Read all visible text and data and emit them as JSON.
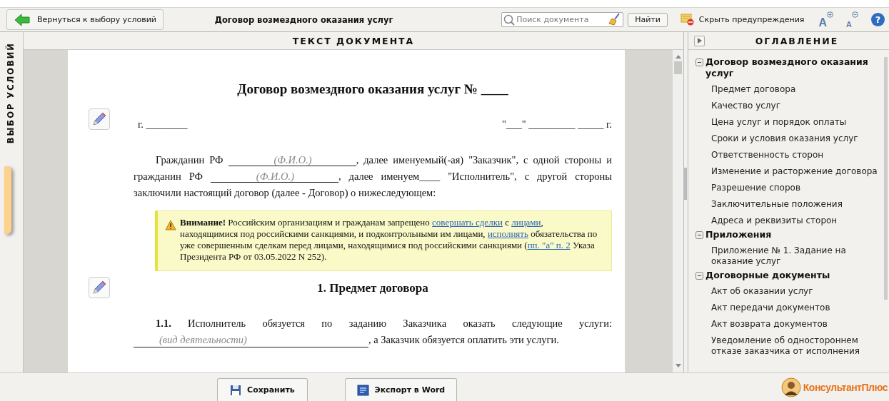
{
  "toolbar": {
    "back_button": "Вернуться к выбору условий",
    "title": "Договор возмездного оказания услуг",
    "search": {
      "placeholder": "Поиск документа"
    },
    "find_button": "Найти",
    "hide_warnings_button": "Скрыть предупреждения",
    "font_buttons": [
      {
        "kind": "increase",
        "label": "A"
      },
      {
        "kind": "decrease",
        "label": "A"
      }
    ],
    "help_button": "?"
  },
  "side_tab": {
    "label": "ВЫБОР УСЛОВИЙ"
  },
  "document": {
    "header": "ТЕКСТ ДОКУМЕНТА",
    "title": "Договор возмездного оказания услуг № ____",
    "city": "г. ________",
    "date": "\"___\" _________ _____ г.",
    "intro": [
      {
        "kind": "text",
        "text": "Гражданин РФ "
      },
      {
        "kind": "blank",
        "hint": "(Ф.И.О.)"
      },
      {
        "kind": "text",
        "text": ", далее именуемый(-ая) \"Заказчик\", с одной стороны и гражданин РФ "
      },
      {
        "kind": "blank",
        "hint": "(Ф.И.О.)"
      },
      {
        "kind": "text",
        "text": ", далее именуем____ \"Исполнитель\", с другой стороны заключили настоящий договор (далее - Договор) о нижеследующем:"
      }
    ],
    "warning": [
      {
        "kind": "text",
        "text": "**Внимание!** Российским организациям и гражданам запрещено "
      },
      {
        "kind": "link",
        "text": "совершать сделки"
      },
      {
        "kind": "text",
        "text": " с "
      },
      {
        "kind": "link",
        "text": "лицами"
      },
      {
        "kind": "text",
        "text": ", находящимися под российскими санкциями, и подконтрольными им лицами, "
      },
      {
        "kind": "link",
        "text": "исполнять"
      },
      {
        "kind": "text",
        "text": " обязательства по уже совершенным сделкам перед лицами, находящимися под российскими санкциями ("
      },
      {
        "kind": "link",
        "text": "пп. \"а\" п. 2"
      },
      {
        "kind": "text",
        "text": " Указа Президента РФ от 03.05.2022 N 252)."
      }
    ],
    "section_heading": "1.  Предмет договора",
    "clause": [
      {
        "kind": "text",
        "text": "**1.1.**  Исполнитель обязуется по заданию Заказчика оказать следующие услуги: "
      },
      {
        "kind": "blank",
        "hint": "(вид деятельности)"
      },
      {
        "kind": "text",
        "text": ", а Заказчик обязуется оплатить эти услуги."
      }
    ]
  },
  "toc": {
    "header": "ОГЛАВЛЕНИЕ",
    "groups": [
      {
        "title": "Договор возмездного оказания услуг",
        "expanded": true,
        "children": [
          "Предмет договора",
          "Качество услуг",
          "Цена услуг и порядок оплаты",
          "Сроки и условия оказания услуг",
          "Ответственность сторон",
          "Изменение и расторжение договора",
          "Разрешение споров",
          "Заключительные положения",
          "Адреса и реквизиты сторон"
        ]
      },
      {
        "title": "Приложения",
        "expanded": true,
        "children": [
          "Приложение № 1. Задание на оказание услуг"
        ]
      },
      {
        "title": "Договорные документы",
        "expanded": true,
        "children": [
          "Акт об оказании услуг",
          "Акт передачи документов",
          "Акт возврата документов",
          "Уведомление об одностороннем отказе заказчика от исполнения"
        ]
      }
    ]
  },
  "footer": {
    "save_button": "Сохранить",
    "export_button": "Экспорт в Word",
    "logo": "КонсультантПлюс"
  }
}
